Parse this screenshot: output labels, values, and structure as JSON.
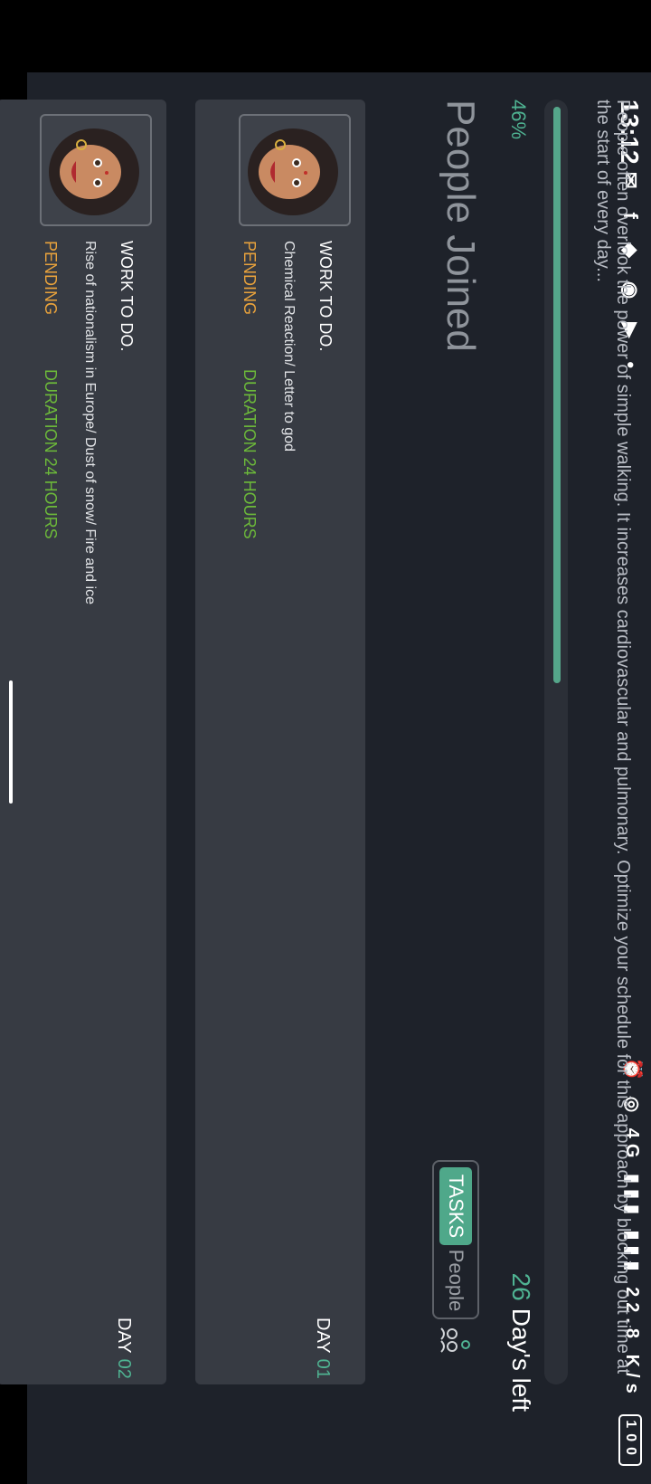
{
  "status_bar": {
    "time": "13:12",
    "left_icons": "✉ f ◆ ◉ ▶ •",
    "right_icons": "⏰ ◎ 4G ▮▮▮ ▮▮▮ 22.8 K/s",
    "battery": "100"
  },
  "challenge": {
    "description": "People often overlook the power of simple walking. It increases cardiovascular and pulmonary. Optimize your schedule for this approach by blocking out time at the start of every day...",
    "progress_percent": 46,
    "progress_label": "46%",
    "days_left_number": "26",
    "days_left_label": "Day's left",
    "people_joined": "People Joined"
  },
  "tabs": {
    "tasks": "TASKS",
    "people": "People"
  },
  "icons": {
    "group": "group-icon",
    "avatar": "avatar-icon"
  },
  "tasks": [
    {
      "title": "WORK TO DO.",
      "subtitle": "Chemical Reaction/ Letter to god",
      "status": "PENDING",
      "duration": "DURATION 24 HOURS",
      "day_label": "DAY",
      "day_number": "01"
    },
    {
      "title": "WORK TO DO.",
      "subtitle": "Rise of nationalism in Europe/ Dust of snow/ Fire and ice",
      "status": "PENDING",
      "duration": "DURATION 24 HOURS",
      "day_label": "DAY",
      "day_number": "02"
    }
  ],
  "colors": {
    "accent": "#4fb392",
    "pending": "#e8a23c",
    "duration": "#6cb93a",
    "background": "#1e222a",
    "card": "#373b43"
  }
}
